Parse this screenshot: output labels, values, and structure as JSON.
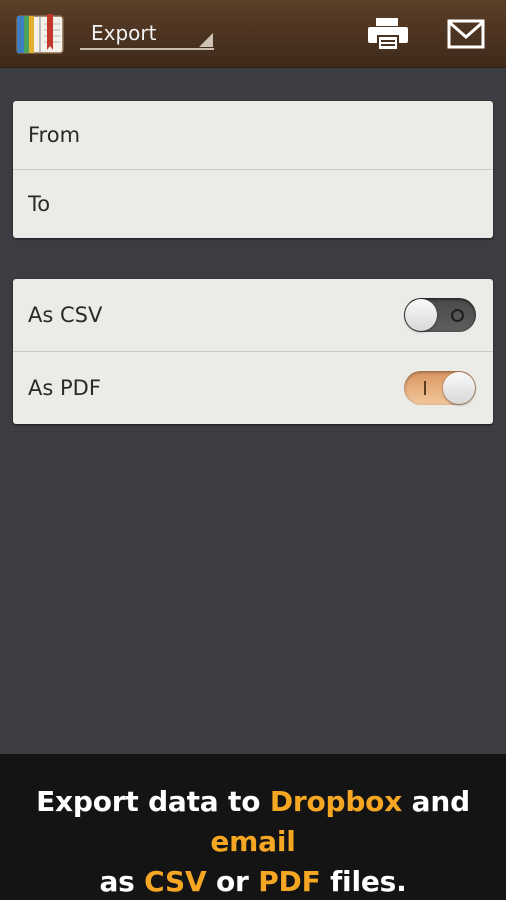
{
  "action_bar": {
    "title": "Export",
    "icons": {
      "app": "ledger-book-icon",
      "print": "printer-icon",
      "mail": "envelope-icon"
    },
    "colors": {
      "background": "#4a3220"
    }
  },
  "date_card": {
    "from_label": "From",
    "to_label": "To"
  },
  "format_card": {
    "csv": {
      "label": "As CSV",
      "enabled": false
    },
    "pdf": {
      "label": "As PDF",
      "enabled": true
    }
  },
  "footer": {
    "line1": {
      "part1": "Export data to ",
      "dropbox": "Dropbox",
      "part2": " and ",
      "email": "email"
    },
    "line2": {
      "part1": "as ",
      "csv": "CSV",
      "part2": " or ",
      "pdf": "PDF",
      "part3": " files."
    },
    "colors": {
      "highlight": "#f5a623",
      "text": "#ffffff",
      "background": "#141414"
    }
  }
}
